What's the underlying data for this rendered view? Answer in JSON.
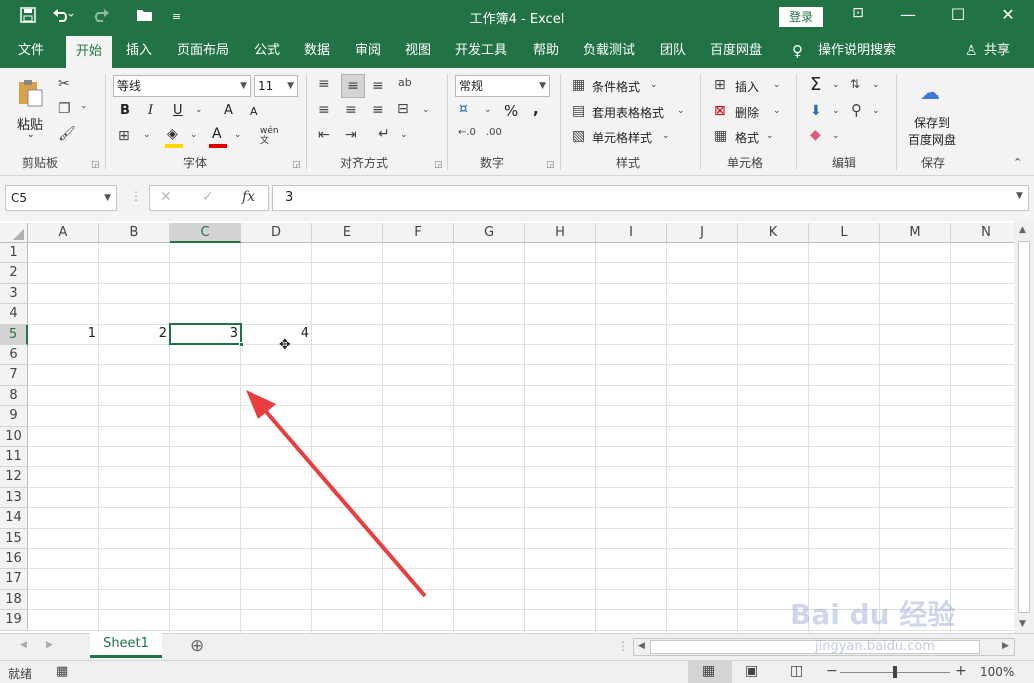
{
  "titlebar": {
    "title": "工作簿4 - Excel",
    "login": "登录",
    "save_icon": "save-icon",
    "undo_icon": "undo-icon",
    "redo_icon": "redo-icon",
    "open_icon": "open-icon",
    "qat_more_icon": "qat-customize-icon",
    "min": "—",
    "max": "☐",
    "close": "✕",
    "ribbon_display": "⊡"
  },
  "tabs": [
    "文件",
    "开始",
    "插入",
    "页面布局",
    "公式",
    "数据",
    "审阅",
    "视图",
    "开发工具",
    "帮助",
    "负载测试",
    "团队",
    "百度网盘",
    "操作说明搜索"
  ],
  "share": "共享",
  "ribbon": {
    "clipboard": {
      "paste": "粘贴",
      "group": "剪贴板"
    },
    "font": {
      "name": "等线",
      "size": "11",
      "bold": "B",
      "italic": "I",
      "underline": "U",
      "grow": "A",
      "shrink": "A",
      "fontcolor": "A",
      "wen": "wén文",
      "group": "字体"
    },
    "align": {
      "group": "对齐方式"
    },
    "number": {
      "format": "常规",
      "percent": "%",
      "comma": ",",
      "group": "数字"
    },
    "styles": {
      "cond": "条件格式",
      "table": "套用表格格式",
      "cell": "单元格样式",
      "group": "样式"
    },
    "cells": {
      "insert": "插入",
      "delete": "删除",
      "format": "格式",
      "group": "单元格"
    },
    "edit": {
      "sum": "Σ",
      "group": "编辑"
    },
    "save": {
      "line1": "保存到",
      "line2": "百度网盘",
      "group": "保存"
    }
  },
  "formula_bar": {
    "namebox": "C5",
    "cancel": "✕",
    "enter": "✓",
    "fx": "fx",
    "value": "3"
  },
  "columns": [
    "A",
    "B",
    "C",
    "D",
    "E",
    "F",
    "G",
    "H",
    "I",
    "J",
    "K",
    "L",
    "M",
    "N"
  ],
  "rows": [
    "1",
    "2",
    "3",
    "4",
    "5",
    "6",
    "7",
    "8",
    "9",
    "10",
    "11",
    "12",
    "13",
    "14",
    "15",
    "16",
    "17",
    "18",
    "19"
  ],
  "cells": {
    "A5": "1",
    "B5": "2",
    "C5": "3",
    "D5": "4"
  },
  "selected_cell": "C5",
  "sheet": {
    "tab": "Sheet1",
    "add": "⊕"
  },
  "status": {
    "mode": "就绪",
    "zoom": "100%",
    "minus": "−",
    "plus": "+"
  },
  "watermark": {
    "line1": "Bai du 经验",
    "line2": "jingyan.baidu.com"
  },
  "accent": "#217346"
}
